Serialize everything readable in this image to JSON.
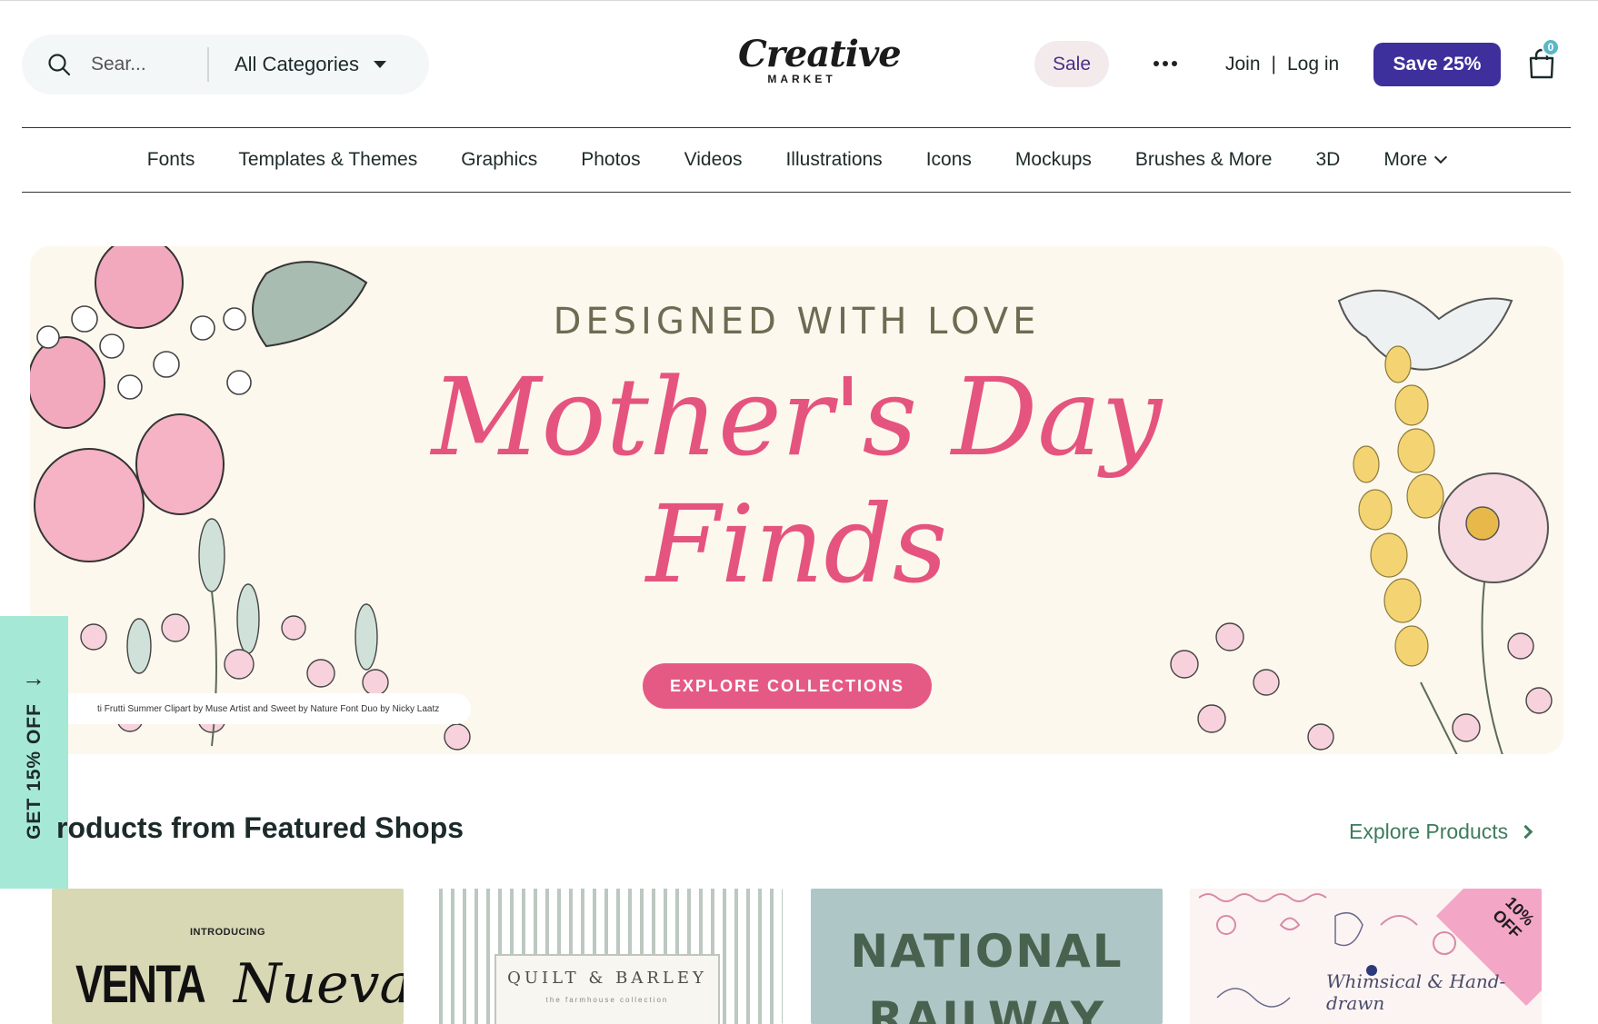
{
  "header": {
    "search_placeholder": "Sear...",
    "categories_label": "All Categories",
    "logo_main": "Creative",
    "logo_sub": "MARKET",
    "sale_label": "Sale",
    "join_label": "Join",
    "separator": "|",
    "login_label": "Log in",
    "save_label": "Save 25%",
    "cart_count": "0"
  },
  "nav": {
    "items": [
      "Fonts",
      "Templates & Themes",
      "Graphics",
      "Photos",
      "Videos",
      "Illustrations",
      "Icons",
      "Mockups",
      "Brushes & More",
      "3D"
    ],
    "more_label": "More"
  },
  "hero": {
    "kicker": "DESIGNED WITH LOVE",
    "title_line1": "Mother's Day",
    "title_line2": "Finds",
    "cta_label": "EXPLORE COLLECTIONS",
    "credit": "ti Frutti Summer Clipart by Muse Artist and Sweet by Nature Font Duo by Nicky Laatz"
  },
  "side_tab": {
    "label": "GET 15% OFF"
  },
  "featured": {
    "title": "roducts from Featured Shops",
    "explore_label": "Explore Products",
    "cards": [
      {
        "intro": "INTRODUCING",
        "title": "VENTA",
        "title2": "Nueva"
      },
      {
        "title": "QUILT & BARLEY",
        "sub": "the farmhouse collection"
      },
      {
        "title": "NATIONAL RAILWAY"
      },
      {
        "badge": "10% OFF",
        "script": "Whimsical & Hand-drawn"
      }
    ]
  },
  "colors": {
    "brand_purple": "#3d2f9c",
    "hero_pink": "#e5547f",
    "side_tab_mint": "#a5e8d5",
    "explore_green": "#3d7c5e"
  }
}
